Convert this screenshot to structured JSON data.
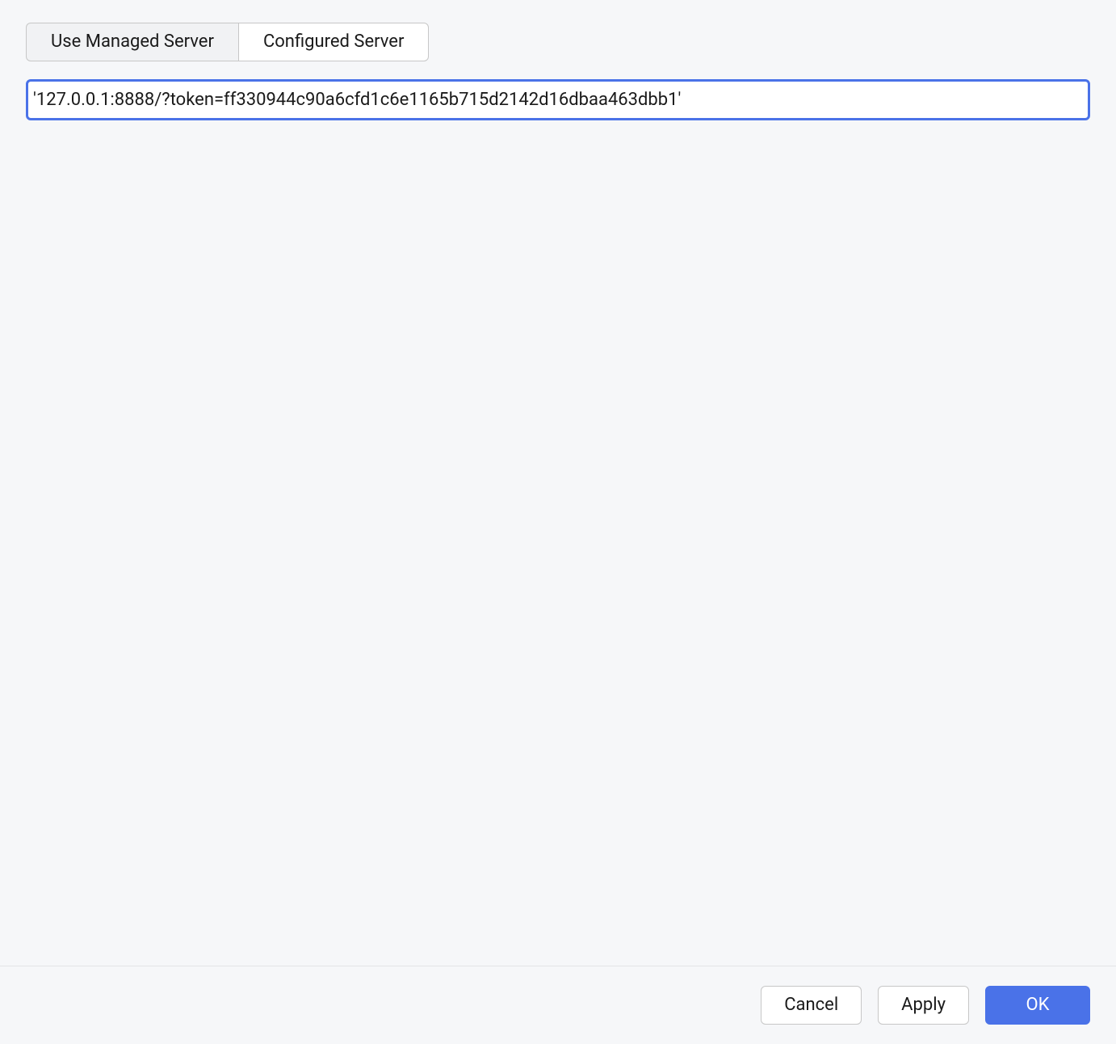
{
  "tabs": {
    "managed": "Use Managed Server",
    "configured": "Configured Server"
  },
  "server_url": {
    "value": "'127.0.0.1:8888/?token=ff330944c90a6cfd1c6e1165b715d2142d16dbaa463dbb1'"
  },
  "footer": {
    "cancel": "Cancel",
    "apply": "Apply",
    "ok": "OK"
  }
}
